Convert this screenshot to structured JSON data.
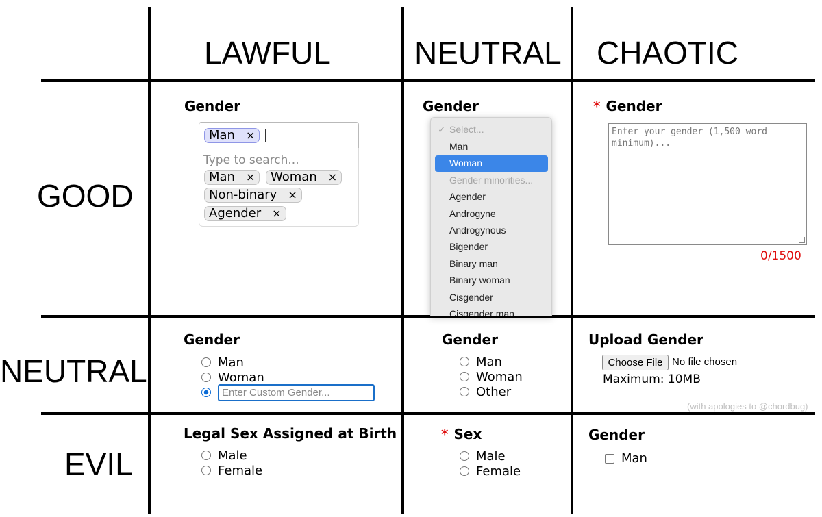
{
  "headers": {
    "columns": [
      "LAWFUL",
      "NEUTRAL",
      "CHAOTIC"
    ],
    "rows": [
      "GOOD",
      "NEUTRAL",
      "EVIL"
    ]
  },
  "lawful_good": {
    "label": "Gender",
    "selected": [
      {
        "label": "Man",
        "remove": "×"
      }
    ],
    "search_placeholder": "Type to search...",
    "options": [
      {
        "label": "Man",
        "remove": "×"
      },
      {
        "label": "Woman",
        "remove": "×"
      },
      {
        "label": "Non-binary",
        "remove": "×"
      },
      {
        "label": "Agender",
        "remove": "×"
      }
    ]
  },
  "neutral_good": {
    "label": "Gender",
    "check_mark": "✓",
    "options": [
      {
        "label": "Select..."
      },
      {
        "label": "Man"
      },
      {
        "label": "Woman"
      },
      {
        "label": "Gender minorities..."
      },
      {
        "label": "Agender"
      },
      {
        "label": "Androgyne"
      },
      {
        "label": "Androgynous"
      },
      {
        "label": "Bigender"
      },
      {
        "label": "Binary man"
      },
      {
        "label": "Binary woman"
      },
      {
        "label": "Cisgender"
      },
      {
        "label": "Cisgender man"
      }
    ],
    "highlighted": "Woman"
  },
  "chaotic_good": {
    "required_mark": "*",
    "label": "Gender",
    "placeholder": "Enter your gender (1,500 word minimum)...",
    "counter": "0/1500"
  },
  "lawful_neutral": {
    "label": "Gender",
    "options": [
      {
        "label": "Man"
      },
      {
        "label": "Woman"
      }
    ],
    "custom_placeholder": "Enter Custom Gender..."
  },
  "true_neutral": {
    "label": "Gender",
    "options": [
      {
        "label": "Man"
      },
      {
        "label": "Woman"
      },
      {
        "label": "Other"
      }
    ]
  },
  "chaotic_neutral": {
    "label": "Upload Gender",
    "button": "Choose File",
    "status": "No file chosen",
    "maximum": "Maximum: 10MB",
    "credit": "(with apologies to @chordbug)"
  },
  "lawful_evil": {
    "label": "Legal Sex Assigned at Birth",
    "options": [
      {
        "label": "Male"
      },
      {
        "label": "Female"
      }
    ]
  },
  "neutral_evil": {
    "required_mark": "*",
    "label": "Sex",
    "options": [
      {
        "label": "Male"
      },
      {
        "label": "Female"
      }
    ]
  },
  "chaotic_evil": {
    "label": "Gender",
    "checkbox_label": "Man"
  },
  "colors": {
    "required": "#e01010",
    "highlight": "#3b86e8",
    "chip_selected": "#dfe1fb",
    "focus_ring": "#1a6fc9"
  }
}
